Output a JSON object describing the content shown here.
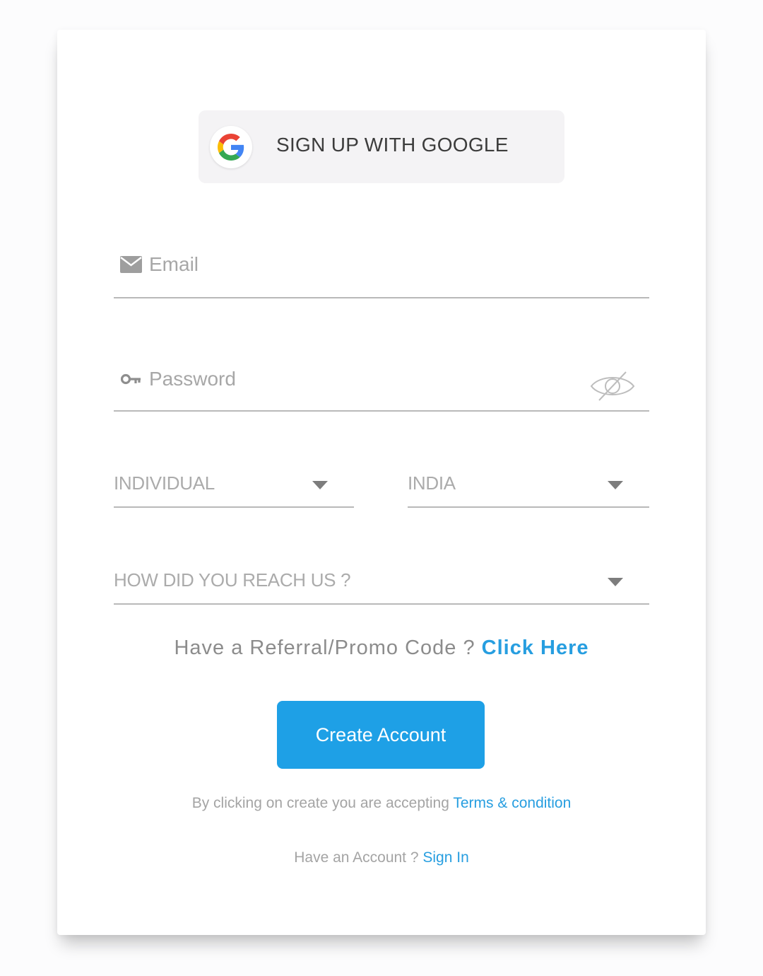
{
  "google_button": {
    "label": "SIGN UP WITH GOOGLE",
    "icon": "google-logo-icon"
  },
  "email_field": {
    "placeholder": "Email",
    "icon": "envelope-icon"
  },
  "password_field": {
    "placeholder": "Password",
    "icon": "key-icon",
    "toggle_icon": "eye-slash-icon"
  },
  "account_type_select": {
    "selected": "INDIVIDUAL",
    "icon": "chevron-down-icon"
  },
  "country_select": {
    "selected": "INDIA",
    "icon": "chevron-down-icon"
  },
  "source_select": {
    "placeholder": "HOW DID YOU REACH US ?",
    "icon": "chevron-down-icon"
  },
  "referral": {
    "prompt": "Have a Referral/Promo Code ?",
    "link": "Click Here"
  },
  "create_button": {
    "label": "Create Account"
  },
  "terms": {
    "text": "By clicking on create you are accepting",
    "link": "Terms & condition"
  },
  "signin": {
    "text": "Have an Account ?",
    "link": "Sign In"
  },
  "colors": {
    "accent": "#1ea0e6",
    "link": "#279ee0",
    "placeholder": "#a7a7a7",
    "underline": "#b9b9b9",
    "google_button_bg": "#f4f3f5"
  }
}
